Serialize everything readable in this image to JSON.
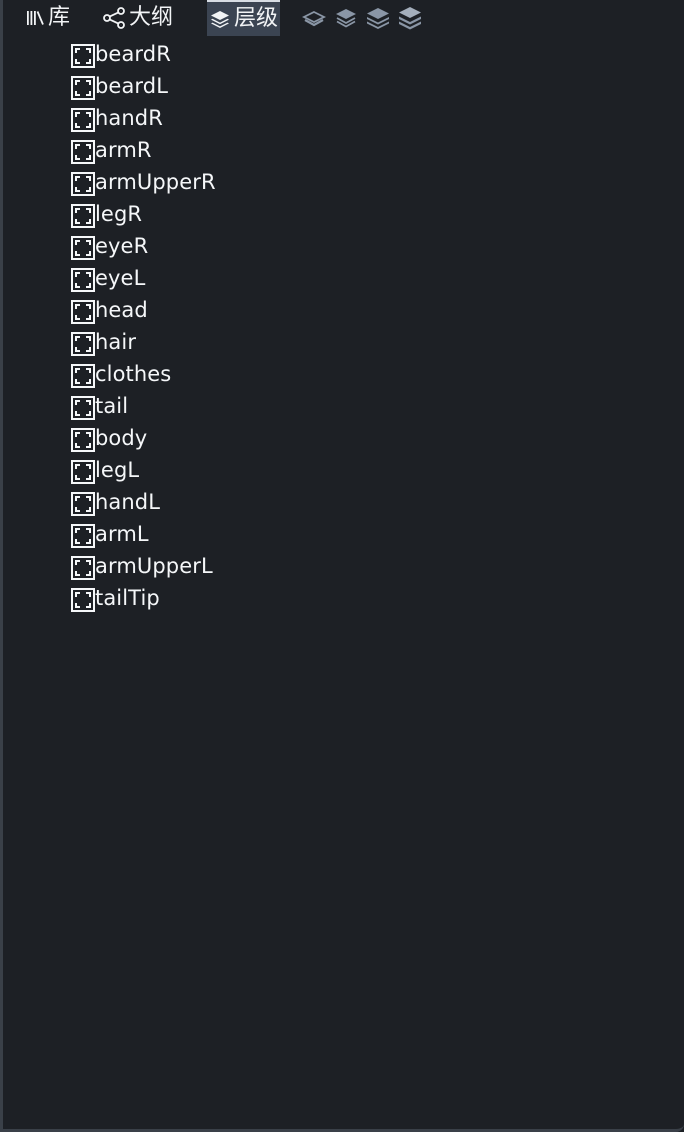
{
  "tabs": [
    {
      "id": "library",
      "label": "库",
      "icon": "library-icon",
      "active": false
    },
    {
      "id": "outline",
      "label": "大纲",
      "icon": "share-nodes-icon",
      "active": false
    },
    {
      "id": "layers",
      "label": "层级",
      "icon": "layers-icon",
      "active": true
    }
  ],
  "layer_tools": [
    {
      "icon": "layer-move-down-icon"
    },
    {
      "icon": "layer-move-up-icon"
    },
    {
      "icon": "layer-send-to-back-icon"
    },
    {
      "icon": "layer-bring-to-front-icon"
    }
  ],
  "layers": [
    "beardR",
    "beardL",
    "handR",
    "armR",
    "armUpperR",
    "legR",
    "eyeR",
    "eyeL",
    "head",
    "hair",
    "clothes",
    "tail",
    "body",
    "legL",
    "handL",
    "armL",
    "armUpperL",
    "tailTip"
  ],
  "colors": {
    "background": "#1d2025",
    "active_tab": "#3b4452",
    "text": "#f5f7f9",
    "tool_icon": "#8a96a6"
  }
}
